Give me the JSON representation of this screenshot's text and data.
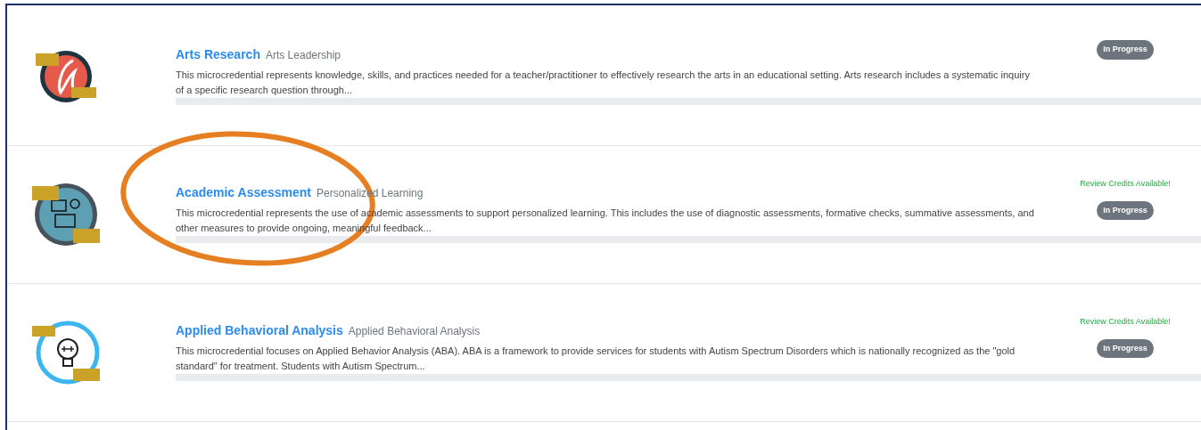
{
  "courses": [
    {
      "kind": "arts",
      "title": "Arts Research",
      "category": "Arts Leadership",
      "description": "This microcredential represents knowledge, skills, and practices needed for a teacher/practitioner to effectively research the arts in an educational setting. Arts research includes a systematic inquiry of a specific research question through...",
      "status": "In Progress",
      "level": 0
    },
    {
      "kind": "assessment",
      "title": "Academic Assessment",
      "category": "Personalized Learning",
      "description": "This microcredential represents the use of academic assessments to support personalized learning. This includes the use of diagnostic assessments, formative checks, summative assessments, and other measures to provide ongoing, meaningful feedback...",
      "review_credits": "Review Credits Available!",
      "status": "In Progress",
      "level": 0
    },
    {
      "kind": "aba",
      "title": "Applied Behavioral Analysis",
      "category": "Applied Behavioral Analysis",
      "description": "This microcredential focuses on Applied Behavior Analysis (ABA). ABA is a framework to provide services for students with Autism Spectrum Disorders which is nationally recognized as the \"gold standard\" for treatment. Students with Autism Spectrum...",
      "review_credits": "Review Credits Available!",
      "status": "In Progress",
      "level": 0
    }
  ]
}
